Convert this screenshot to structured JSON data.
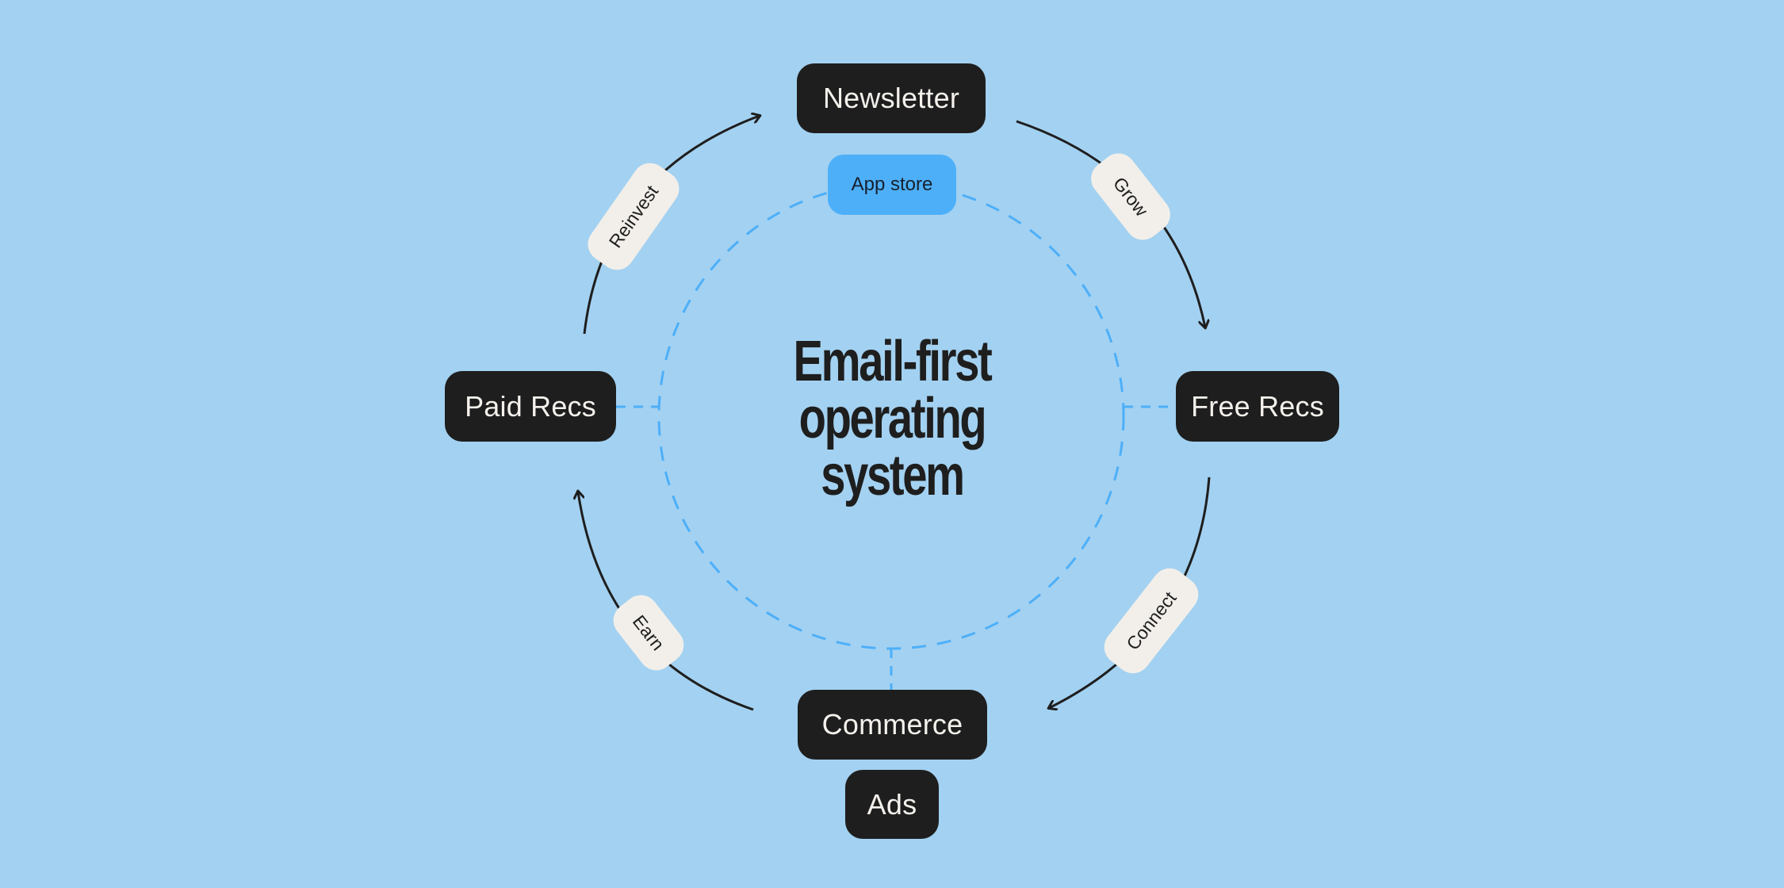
{
  "title": {
    "lines": [
      "Email-first",
      "operating",
      "system"
    ]
  },
  "nodes": {
    "top": "Newsletter",
    "right": "Free Recs",
    "bottom": "Commerce",
    "bottom_extra": "Ads",
    "left": "Paid Recs",
    "inner_top": "App store"
  },
  "edges": [
    {
      "from": "Newsletter",
      "to": "Free Recs",
      "label": "Grow"
    },
    {
      "from": "Free Recs",
      "to": "Commerce",
      "label": "Connect"
    },
    {
      "from": "Commerce",
      "to": "Paid Recs",
      "label": "Earn"
    },
    {
      "from": "Paid Recs",
      "to": "Newsletter",
      "label": "Reinvest"
    }
  ],
  "colors": {
    "background": "#A3D1F1",
    "node": "#1E1E1E",
    "node_text": "#F4F1EC",
    "accent": "#4DAFF8",
    "pill": "#F2EFEA",
    "dashed": "#4DAFF8"
  }
}
